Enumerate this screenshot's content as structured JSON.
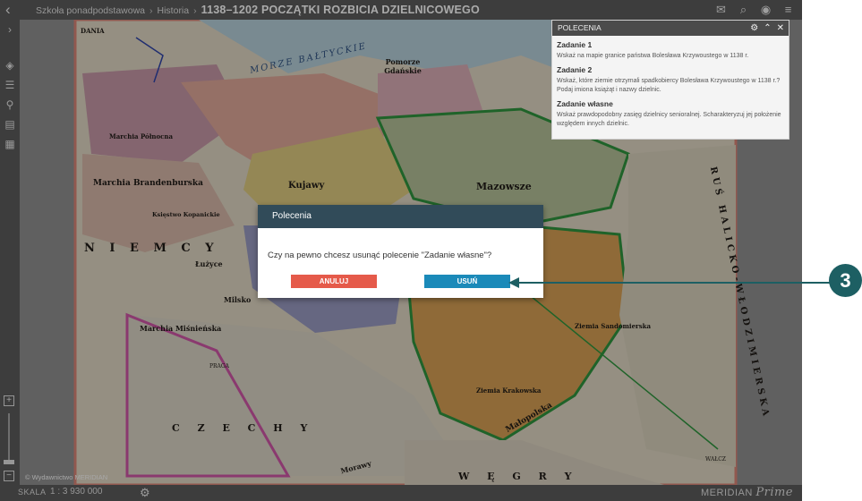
{
  "header": {
    "breadcrumb": [
      "Szkoła ponadpodstawowa",
      "Historia"
    ],
    "title": "1138–1202 POCZĄTKI ROZBICIA DZIELNICOWEGO"
  },
  "tasks_panel": {
    "title": "POLECENIA",
    "tasks": [
      {
        "title": "Zadanie 1",
        "text": "Wskaż na mapie granice państwa Bolesława Krzywoustego w 1138 r."
      },
      {
        "title": "Zadanie 2",
        "text": "Wskaż, które ziemie otrzymali spadkobiercy Bolesława Krzywoustego w 1138 r.? Podaj imiona książąt i nazwy dzielnic."
      },
      {
        "title": "Zadanie własne",
        "text": "Wskaż prawdopodobny zasięg dzielnicy senioralnej. Scharakteryzuj jej położenie względem innych dzielnic."
      }
    ]
  },
  "modal": {
    "title": "Polecenia",
    "message": "Czy na pewno chcesz usunąć polecenie \"Zadanie własne\"?",
    "cancel_label": "ANULUJ",
    "delete_label": "USUŃ"
  },
  "callout": {
    "number": "3"
  },
  "map": {
    "copyright": "© Wydawnictwo MERIDIAN",
    "labels": {
      "dania": "DANIA",
      "sea": "MORZE BAŁTYCKIE",
      "pomorze": "Pomorze Gdańskie",
      "pomorze_zach": "Pomorze",
      "mazowsze": "Mazowsze",
      "kujawy": "Kujawy",
      "marchia_polnocna": "Marchia Północna",
      "marchia_brand": "Marchia Brandenburska",
      "ksiestwo_kopanickie": "Księstwo Kopanickie",
      "niemcy": "N I E M C Y",
      "lużyce": "Łużyce",
      "milsko": "Milsko",
      "marchia_misn": "Marchia Miśnieńska",
      "czechy": "C Z E C H Y",
      "morawy": "Morawy",
      "wegry": "W Ę G R Y",
      "ziemia_krakowska": "Ziemia Krakowska",
      "ziemia_sandomierska": "Ziemia Sandomierska",
      "malopolska": "Małopolska",
      "rus": "RUŚ HALICKO-WŁODZIMIERSKA",
      "praga": "PRAGA",
      "walcz": "WAŁCZ"
    }
  },
  "bottom": {
    "scale_label": "SKALA",
    "scale_value": "1 : 3 930 000",
    "brand": "MERIDIAN",
    "brand_suffix": "Prime"
  },
  "colors": {
    "accent": "#1d5f63",
    "cancel": "#e55a4a",
    "delete": "#1b8ab9",
    "modal_header": "#314b59"
  }
}
